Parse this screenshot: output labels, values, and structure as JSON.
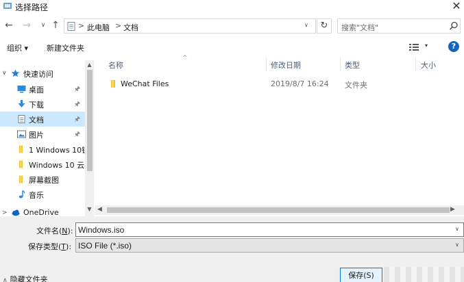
{
  "window": {
    "title": "选择路径",
    "close_glyph": "✕"
  },
  "nav": {
    "back_glyph": "←",
    "forward_glyph": "→",
    "recent_glyph": "∨",
    "up_glyph": "↑",
    "breadcrumb": [
      "此电脑",
      "文档"
    ],
    "separator": ">",
    "dropdown_glyph": "∨",
    "refresh_glyph": "↻",
    "search_placeholder": "搜索\"文档\""
  },
  "toolbar": {
    "organize_label": "组织 ▾",
    "new_folder_label": "新建文件夹",
    "help_label": "?",
    "view_dropdown_glyph": "▾"
  },
  "sidebar": {
    "items": [
      {
        "label": "快速访问",
        "icon": "star-icon",
        "chev": "∨",
        "pinned": false
      },
      {
        "label": "桌面",
        "icon": "desktop-icon",
        "pinned": true
      },
      {
        "label": "下载",
        "icon": "download-icon",
        "pinned": true
      },
      {
        "label": "文档",
        "icon": "document-icon",
        "pinned": true,
        "selected": true
      },
      {
        "label": "图片",
        "icon": "picture-icon",
        "pinned": true
      },
      {
        "label": "1 Windows 10镜",
        "icon": "folder-icon",
        "pinned": false
      },
      {
        "label": "Windows 10 云",
        "icon": "folder-icon",
        "pinned": false
      },
      {
        "label": "屏幕截图",
        "icon": "folder-icon",
        "pinned": false
      },
      {
        "label": "音乐",
        "icon": "music-icon",
        "pinned": false
      },
      {
        "label": "OneDrive",
        "icon": "cloud-icon",
        "chev": ">",
        "pinned": false
      }
    ],
    "pin_glyph": "📌"
  },
  "filelist": {
    "sort_glyph": "^",
    "columns": [
      "名称",
      "修改日期",
      "类型",
      "大小"
    ],
    "rows": [
      {
        "name": "WeChat Files",
        "date": "2019/8/7 16:24",
        "type": "文件夹",
        "size": ""
      }
    ]
  },
  "form": {
    "filename_label": "文件名(",
    "filename_hotkey": "N",
    "filename_label_end": "):",
    "filename_value": "Windows.iso",
    "filetype_label": "保存类型(",
    "filetype_hotkey": "T",
    "filetype_label_end": "):",
    "filetype_value": "ISO File (*.iso)",
    "hide_folders_label": "隐藏文件夹",
    "save_label": "保存(S)"
  },
  "colors": {
    "accent": "#0078d7",
    "selected": "#cce8ff",
    "help": "#1565c0"
  }
}
